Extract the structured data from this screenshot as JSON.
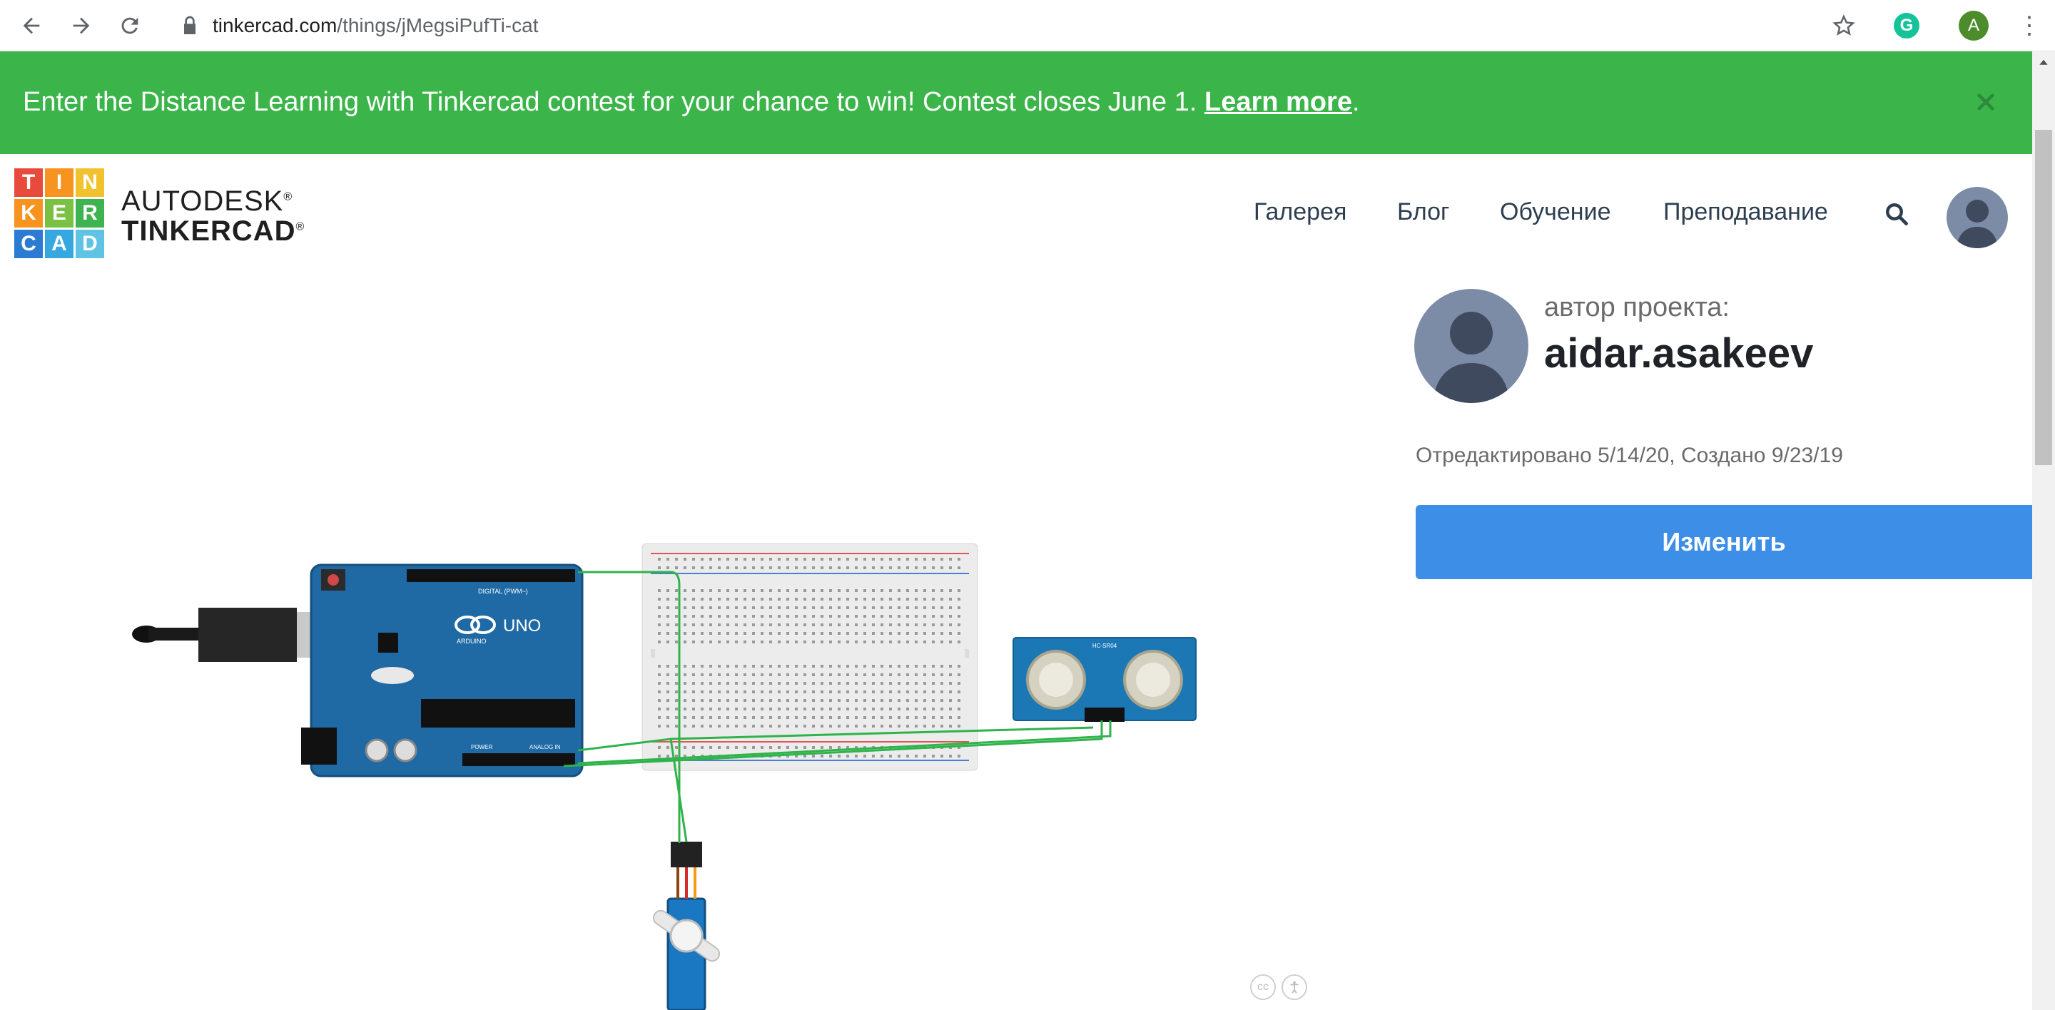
{
  "browser": {
    "url_host": "tinkercad.com",
    "url_path": "/things/jMegsiPufTi-cat",
    "profile_initial": "A",
    "extension_letter": "G"
  },
  "banner": {
    "text": "Enter the Distance Learning with Tinkercad contest for your chance to win! Contest closes June 1. ",
    "link": "Learn more",
    "suffix": ".",
    "color": "#3bb54a"
  },
  "logo": {
    "letters": [
      "T",
      "I",
      "N",
      "K",
      "E",
      "R",
      "C",
      "A",
      "D"
    ],
    "brand_line1": "AUTODESK",
    "brand_line2": "TINKERCAD",
    "registered": "®"
  },
  "nav": {
    "items": [
      "Галерея",
      "Блог",
      "Обучение",
      "Преподавание"
    ]
  },
  "author": {
    "caption": "автор проекта:",
    "name": "aidar.asakeev",
    "dates": "Отредактировано 5/14/20, Создано 9/23/19"
  },
  "actions": {
    "edit_label": "Изменить",
    "accent": "#3d8ee6"
  },
  "circuit": {
    "board_label": "UNO",
    "board_brand": "ARDUINO",
    "digital_label": "DIGITAL (PWM~)",
    "power_label": "POWER",
    "analog_label": "ANALOG IN",
    "sensor_label": "HC-SR04"
  },
  "viewer": {
    "cc_label": "cc"
  }
}
